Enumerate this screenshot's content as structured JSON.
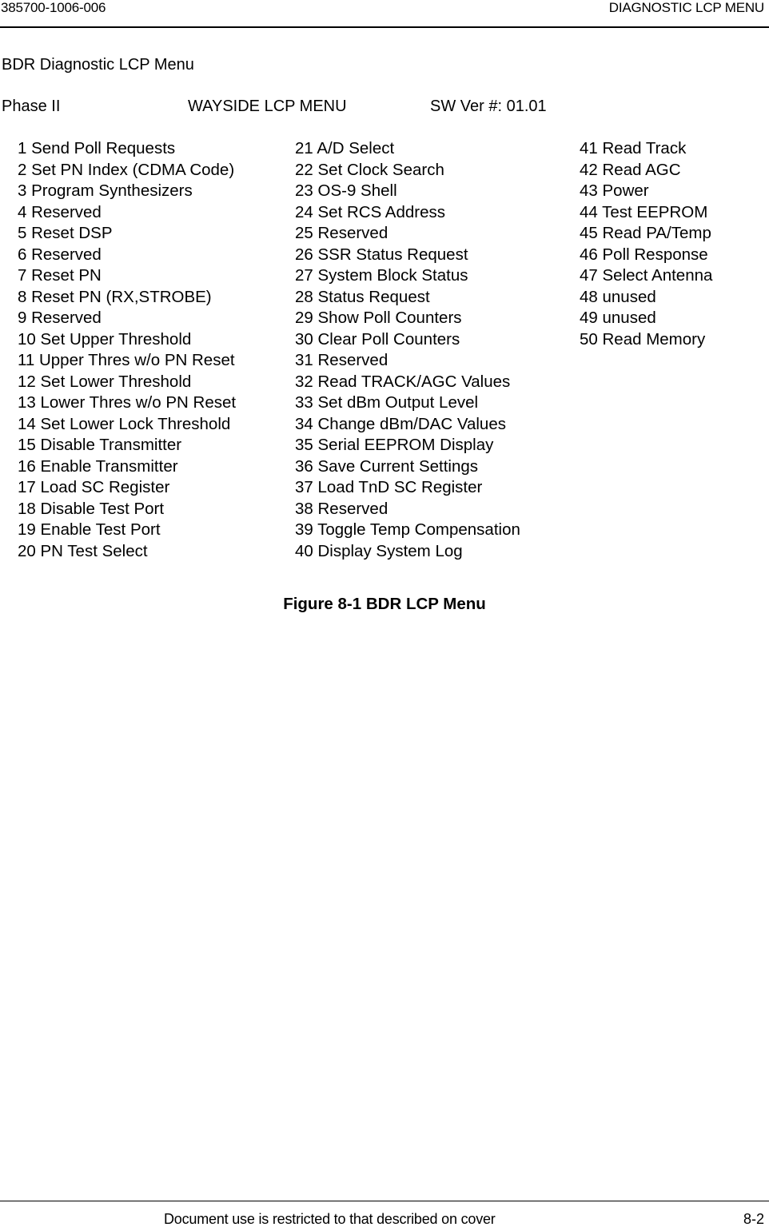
{
  "header": {
    "doc_number": "385700-1006-006",
    "section_title": "DIAGNOSTIC LCP MENU"
  },
  "title": "BDR Diagnostic LCP Menu",
  "menu_header": {
    "phase": "Phase II",
    "menu_name": "WAYSIDE LCP MENU",
    "sw_version": "SW Ver #: 01.01"
  },
  "columns": [
    {
      "items": [
        "1 Send Poll Requests",
        "2 Set PN Index (CDMA Code)",
        "3 Program Synthesizers",
        "4 Reserved",
        "5 Reset DSP",
        "6 Reserved",
        "7 Reset PN",
        "8 Reset PN (RX,STROBE)",
        "9 Reserved",
        "10 Set Upper Threshold",
        "11 Upper Thres w/o PN Reset",
        "12 Set Lower Threshold",
        "13 Lower Thres w/o PN Reset",
        "14 Set Lower Lock Threshold",
        "15 Disable Transmitter",
        "16 Enable Transmitter",
        "17 Load SC Register",
        "18 Disable Test Port",
        "19 Enable Test Port",
        "20 PN Test Select"
      ]
    },
    {
      "items": [
        "21 A/D Select",
        "22 Set Clock Search",
        "23 OS-9 Shell",
        "24 Set RCS Address",
        "25 Reserved",
        "26 SSR Status Request",
        "27 System Block Status",
        "28 Status Request",
        "29 Show Poll Counters",
        "30 Clear Poll Counters",
        "31 Reserved",
        "32 Read TRACK/AGC Values",
        "33 Set dBm Output Level",
        "34 Change dBm/DAC Values",
        "35 Serial EEPROM Display",
        "36 Save Current Settings",
        "37 Load TnD SC Register",
        "38 Reserved",
        "39 Toggle Temp Compensation",
        "40 Display System Log"
      ]
    },
    {
      "items": [
        "41 Read Track",
        "42 Read AGC",
        "43 Power",
        "44 Test EEPROM",
        "45 Read PA/Temp",
        "46 Poll Response",
        "47 Select Antenna",
        "48 unused",
        "49 unused",
        "50 Read Memory"
      ]
    }
  ],
  "caption": "Figure 8-1 BDR LCP Menu",
  "footer": {
    "notice": "Document use is restricted to that described on cover",
    "page_number": "8-2"
  }
}
